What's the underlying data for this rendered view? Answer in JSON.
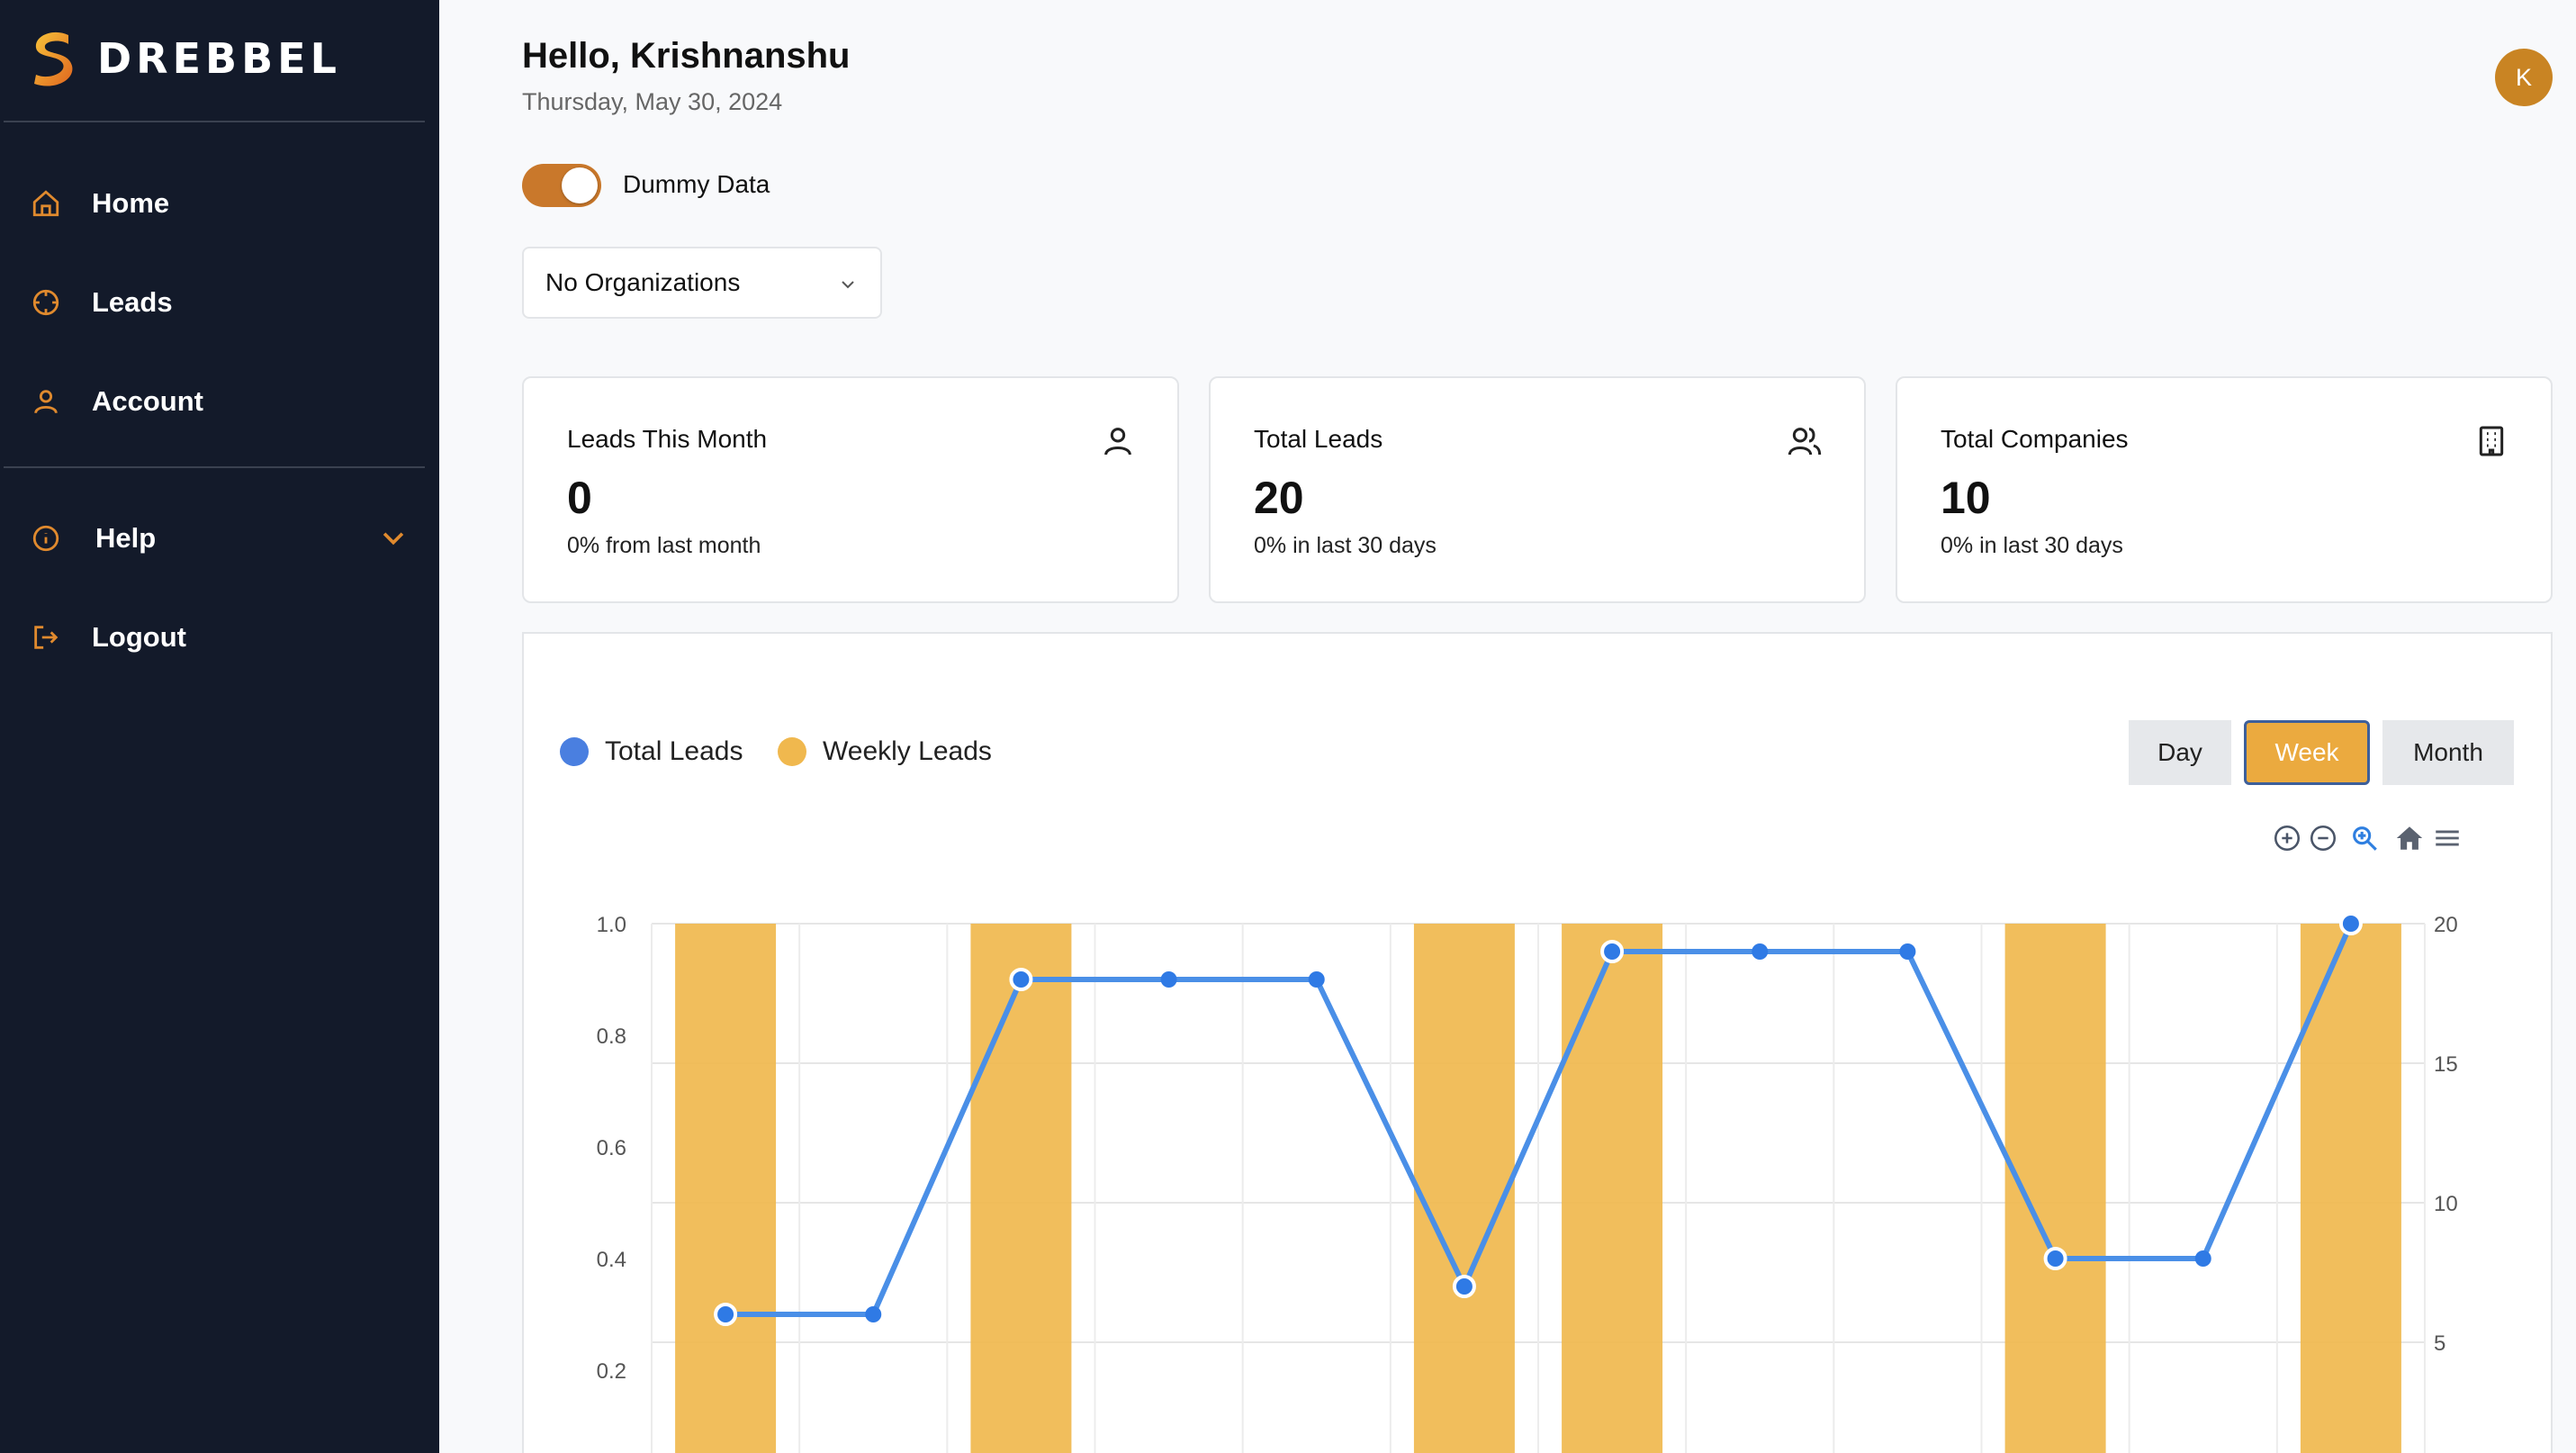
{
  "sidebar": {
    "brand": "DREBBEL",
    "items": [
      {
        "label": "Home"
      },
      {
        "label": "Leads"
      },
      {
        "label": "Account"
      },
      {
        "label": "Help"
      },
      {
        "label": "Logout"
      }
    ]
  },
  "header": {
    "greeting": "Hello, Krishnanshu",
    "date": "Thursday, May 30, 2024",
    "avatar_initial": "K"
  },
  "controls": {
    "toggle_label": "Dummy Data",
    "toggle_on": true,
    "org_select_value": "No Organizations"
  },
  "cards": [
    {
      "title": "Leads This Month",
      "value": "0",
      "sub": "0% from last month",
      "icon": "user-icon"
    },
    {
      "title": "Total Leads",
      "value": "20",
      "sub": "0% in last 30 days",
      "icon": "users-icon"
    },
    {
      "title": "Total Companies",
      "value": "10",
      "sub": "0% in last 30 days",
      "icon": "building-icon"
    }
  ],
  "chart_controls": {
    "ranges": [
      "Day",
      "Week",
      "Month"
    ],
    "active_range": "Week"
  },
  "colors": {
    "accent": "#ebaa3f",
    "sidebar_bg": "#131a2a",
    "line": "#4a8fe7",
    "bar": "#f0b84e"
  },
  "chart_data": {
    "type": "bar",
    "legend_placement": "top-left",
    "series": [
      {
        "name": "Total Leads",
        "type": "line",
        "axis": "right",
        "values": [
          6,
          6,
          18,
          18,
          18,
          7,
          19,
          19,
          19,
          8,
          8,
          20
        ]
      },
      {
        "name": "Weekly Leads",
        "type": "bar",
        "axis": "left",
        "values": [
          1,
          0,
          1,
          0,
          0,
          1,
          1,
          0,
          0,
          1,
          0,
          1
        ]
      }
    ],
    "left_axis": {
      "ticks": [
        "1.0",
        "0.8",
        "0.6",
        "0.4",
        "0.2"
      ],
      "range": [
        0,
        1
      ]
    },
    "right_axis": {
      "ticks": [
        "20",
        "15",
        "10",
        "5"
      ],
      "range": [
        0,
        20
      ]
    },
    "grid": true
  }
}
